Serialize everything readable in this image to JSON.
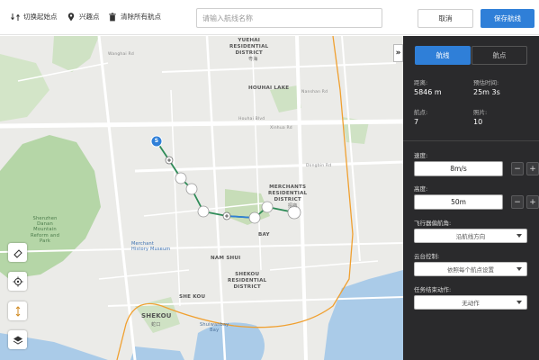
{
  "toolbar": {
    "switch_start_label": "切换起始点",
    "interest_point_label": "兴趣点",
    "clear_waypoints_label": "清除所有航点",
    "route_name_placeholder": "请输入航线名称",
    "cancel_label": "取消",
    "save_label": "保存航线"
  },
  "map": {
    "labels": {
      "yuehai": "YUEHAI\nRESIDENTIAL\nDISTRICT",
      "yuehai_cn": "粤海",
      "houhai_lake": "HOUHAI LAKE",
      "merchants": "MERCHANTS\nRESIDENTIAL\nDISTRICT",
      "merchants_cn": "招商",
      "bay": "BAY",
      "nam_shui": "NAM SHUI",
      "shekou_res": "SHEKOU\nRESIDENTIAL\nDISTRICT",
      "she_kou": "SHE KOU",
      "shekou": "SHEKOU",
      "shekou_cn": "蛇口",
      "shenzhen_park": "Shenzhen\nDanan\nMountain\nReform and\nPark",
      "merchant_museum": "Merchant\nHistory Museum",
      "shuiwan_bay": "Shuiwanbay\nBay",
      "wanghai_rd": "Wanghai Rd",
      "xinhua_rd": "Xinhua Rd",
      "nanshan_rd": "Nanshan Rd",
      "dongbin_rd": "Dongbin Rd",
      "road_houhai": "Houhai Blvd"
    },
    "waypoint_start_label": "S",
    "colors": {
      "route": "#2e8b57",
      "route_highlight": "#2f7fd8",
      "water": "#aacbe8",
      "park": "#b5d6a7",
      "rail": "#f0a030"
    }
  },
  "map_tools": [
    {
      "name": "eraser-tool",
      "icon": "eraser-icon"
    },
    {
      "name": "locate-tool",
      "icon": "locate-icon"
    },
    {
      "name": "altitude-tool",
      "icon": "altitude-icon"
    },
    {
      "name": "layers-tool",
      "icon": "layers-icon"
    }
  ],
  "panel": {
    "tabs": {
      "route": "航线",
      "waypoint": "航点"
    },
    "stats": {
      "distance_label": "距离:",
      "distance_value": "5846 m",
      "time_label": "预估时间:",
      "time_value": "25m 3s",
      "waypoints_label": "航点:",
      "waypoints_value": "7",
      "photos_label": "照片:",
      "photos_value": "10"
    },
    "speed": {
      "label": "速度:",
      "value": "8m/s",
      "minus": "−",
      "plus": "+"
    },
    "altitude": {
      "label": "高度:",
      "value": "50m",
      "minus": "−",
      "plus": "+"
    },
    "heading": {
      "label": "飞行器偏航角:",
      "value": "沿航线方向"
    },
    "gimbal": {
      "label": "云台控制:",
      "value": "依照每个航点设置"
    },
    "finish_action": {
      "label": "任务结束动作:",
      "value": "无动作"
    }
  }
}
